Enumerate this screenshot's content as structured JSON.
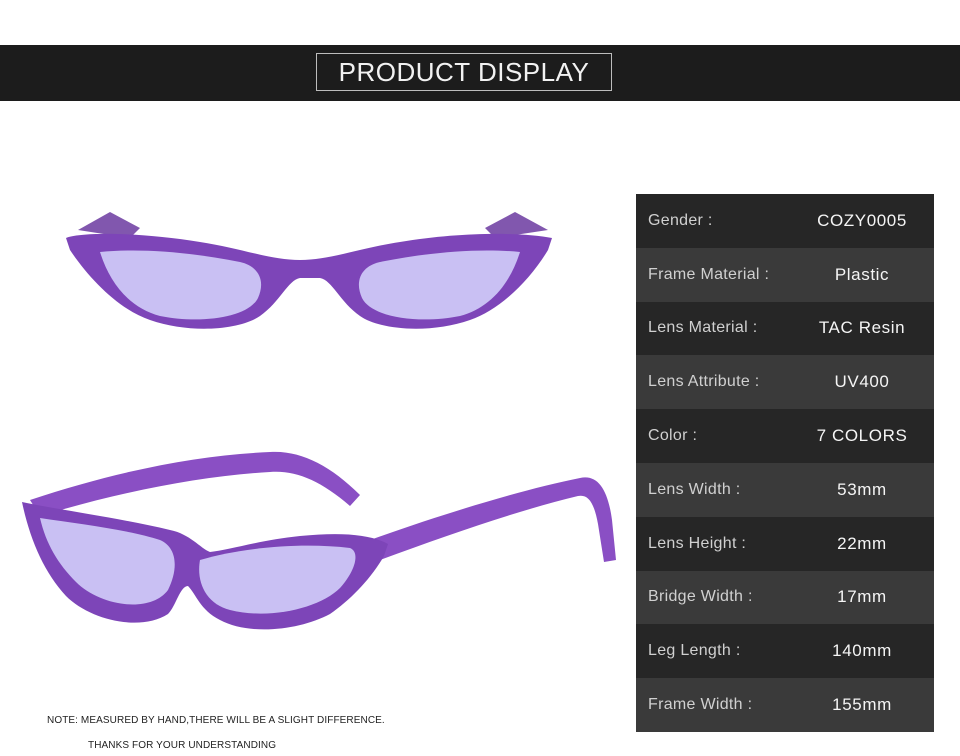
{
  "banner": {
    "title": "PRODUCT DISPLAY"
  },
  "product": {
    "image": "purple-cat-eye-sunglasses",
    "colors": {
      "frame": "#8a4fc4",
      "frame_dark": "#5e2d8f",
      "lens": "#c7bff2"
    }
  },
  "specs": [
    {
      "label": "Gender :",
      "value": "COZY0005"
    },
    {
      "label": "Frame Material :",
      "value": "Plastic"
    },
    {
      "label": "Lens Material :",
      "value": "TAC Resin"
    },
    {
      "label": "Lens Attribute :",
      "value": "UV400"
    },
    {
      "label": "Color :",
      "value": "7 COLORS"
    },
    {
      "label": "Lens Width :",
      "value": "53mm"
    },
    {
      "label": "Lens Height :",
      "value": "22mm"
    },
    {
      "label": "Bridge Width :",
      "value": "17mm"
    },
    {
      "label": "Leg Length :",
      "value": "140mm"
    },
    {
      "label": "Frame Width :",
      "value": "155mm"
    }
  ],
  "notes": {
    "line1": "NOTE: MEASURED BY HAND,THERE WILL BE A SLIGHT DIFFERENCE.",
    "line2": "THANKS FOR YOUR UNDERSTANDING"
  }
}
